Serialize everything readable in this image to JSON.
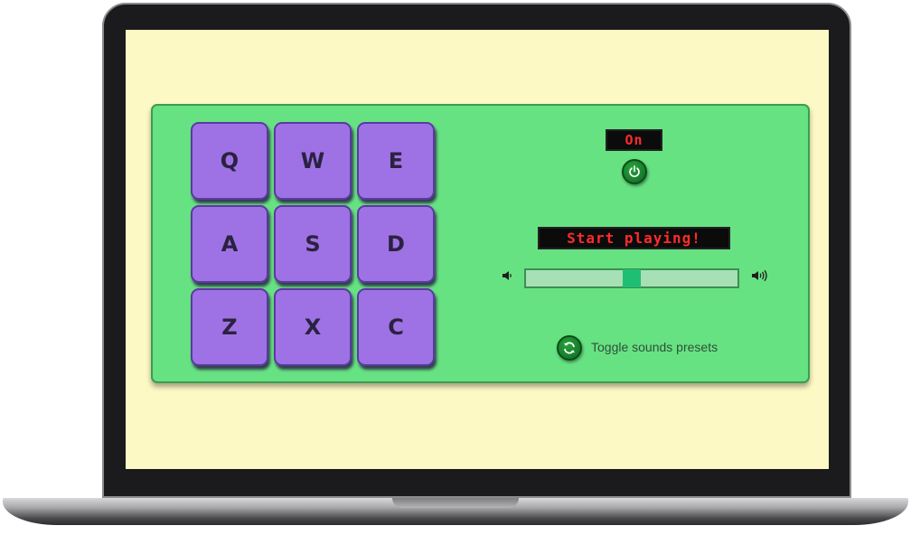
{
  "pads": [
    {
      "key": "Q"
    },
    {
      "key": "W"
    },
    {
      "key": "E"
    },
    {
      "key": "A"
    },
    {
      "key": "S"
    },
    {
      "key": "D"
    },
    {
      "key": "Z"
    },
    {
      "key": "X"
    },
    {
      "key": "C"
    }
  ],
  "power": {
    "status_label": "On",
    "icon": "power-icon"
  },
  "display": {
    "text": "Start playing!"
  },
  "volume": {
    "value": 0.5,
    "low_icon": "volume-low-icon",
    "high_icon": "volume-high-icon"
  },
  "preset": {
    "label": "Toggle sounds presets",
    "icon": "refresh-icon"
  },
  "colors": {
    "screen_background": "#fdf9c4",
    "machine_background": "#67e282",
    "pad": "#9e72e4",
    "lcd_text": "#ff2b2b",
    "button": "#1a8a30",
    "slider_thumb": "#1fbf73"
  }
}
